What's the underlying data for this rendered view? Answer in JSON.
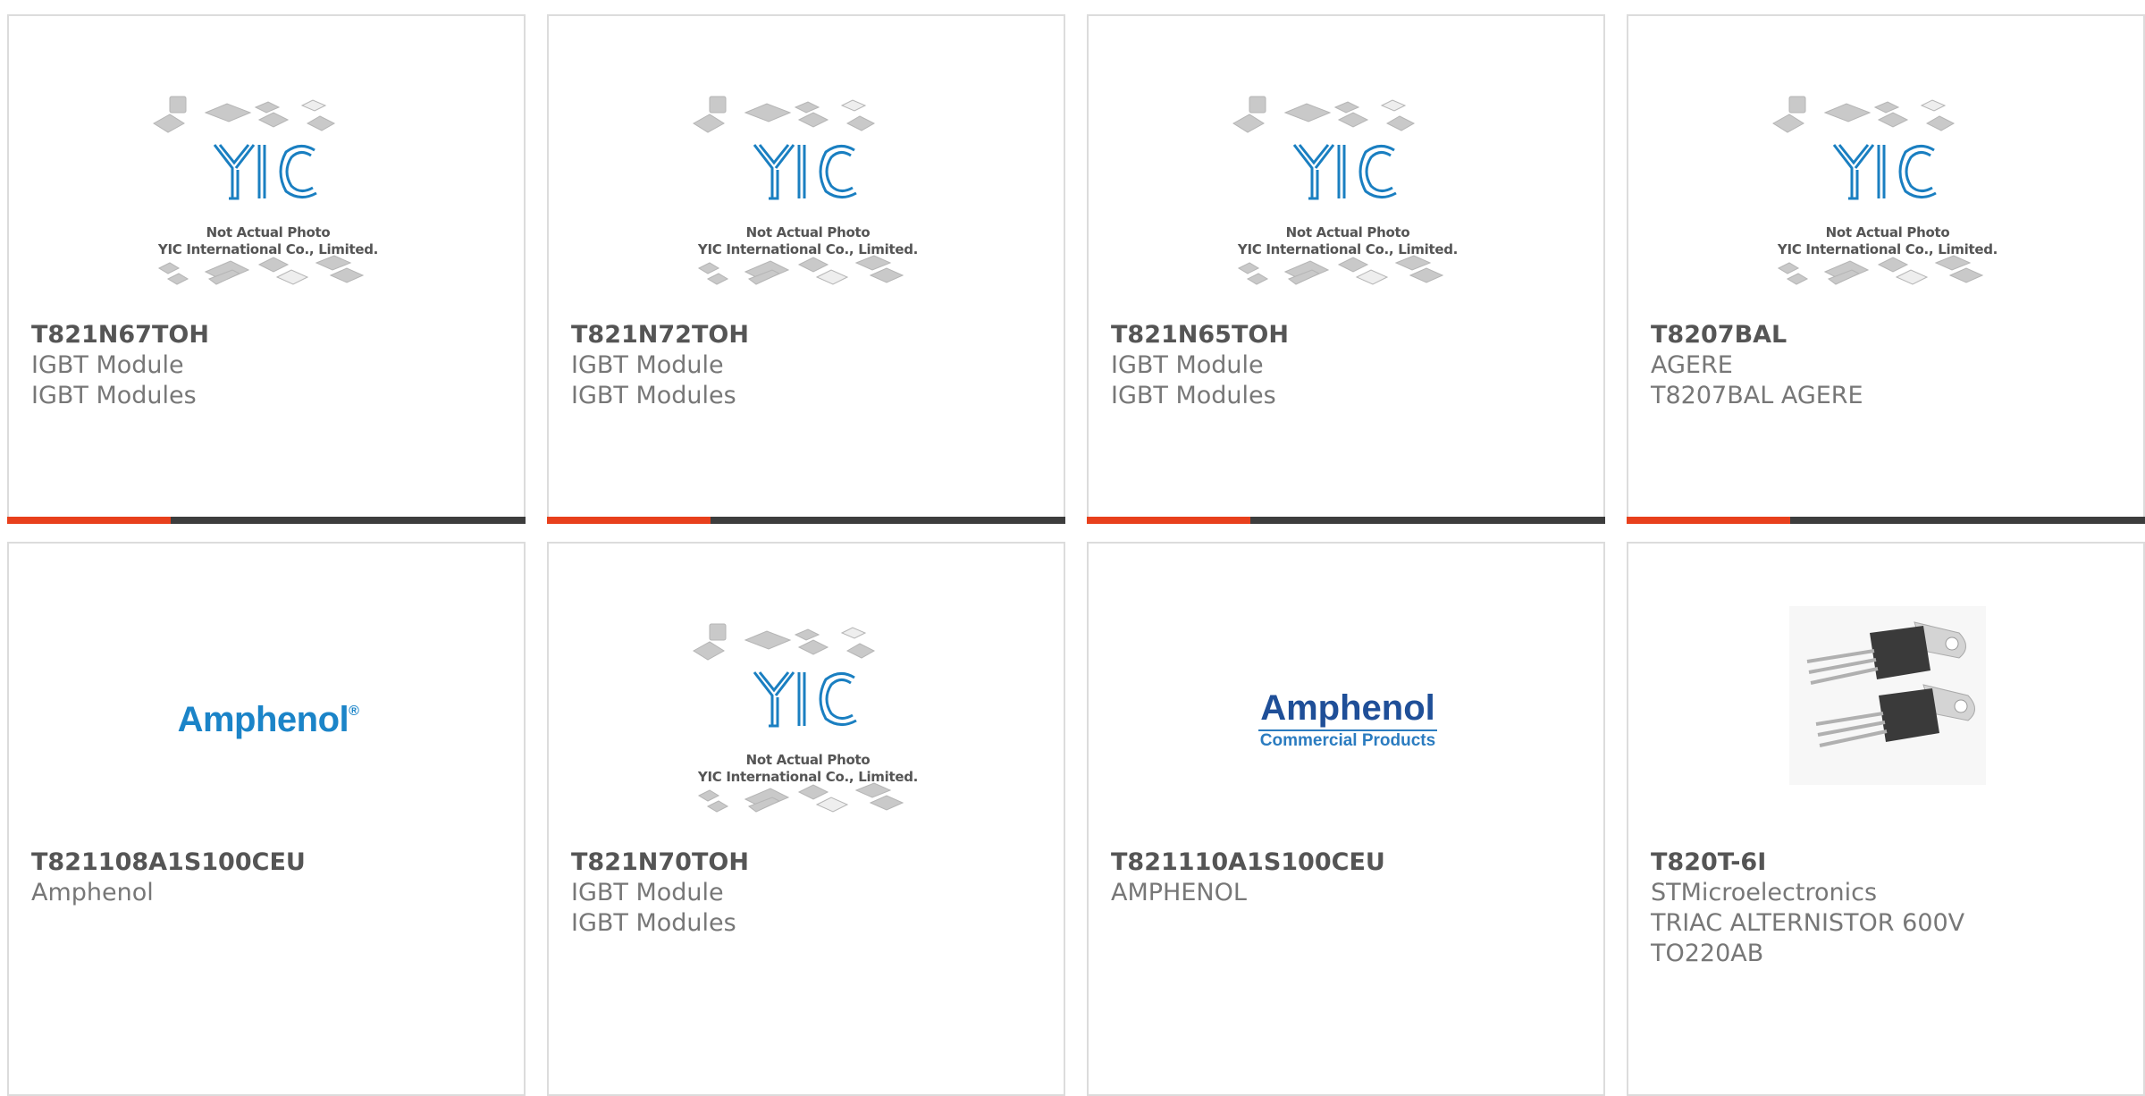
{
  "products": [
    {
      "part": "T821N67TOH",
      "lines": [
        "IGBT Module",
        "IGBT Modules"
      ],
      "image": "yic-placeholder"
    },
    {
      "part": "T821N72TOH",
      "lines": [
        "IGBT Module",
        "IGBT Modules"
      ],
      "image": "yic-placeholder"
    },
    {
      "part": "T821N65TOH",
      "lines": [
        "IGBT Module",
        "IGBT Modules"
      ],
      "image": "yic-placeholder"
    },
    {
      "part": "T8207BAL",
      "lines": [
        "AGERE",
        "T8207BAL AGERE"
      ],
      "image": "yic-placeholder"
    },
    {
      "part": "T821108A1S100CEU",
      "lines": [
        "Amphenol"
      ],
      "image": "amphenol-logo"
    },
    {
      "part": "T821N70TOH",
      "lines": [
        "IGBT Module",
        "IGBT Modules"
      ],
      "image": "yic-placeholder"
    },
    {
      "part": "T821110A1S100CEU",
      "lines": [
        "AMPHENOL"
      ],
      "image": "amphenol-commercial-logo"
    },
    {
      "part": "T820T-6I",
      "lines": [
        "STMicroelectronics",
        "TRIAC ALTERNISTOR 600V",
        "TO220AB"
      ],
      "image": "to220-transistor-photo"
    }
  ],
  "placeholder": {
    "caption_line1": "Not Actual Photo",
    "caption_line2": "YIC International Co., Limited.",
    "logo": "YIC"
  },
  "logos": {
    "amphenol": "Amphenol",
    "amphenol_reg": "®",
    "amphenol_commercial_big": "Amphenol",
    "amphenol_commercial_small": "Commercial Products"
  },
  "colors": {
    "accent": "#e8401c",
    "bar": "#3d3d3d",
    "yic_blue": "#1a7fc1"
  }
}
